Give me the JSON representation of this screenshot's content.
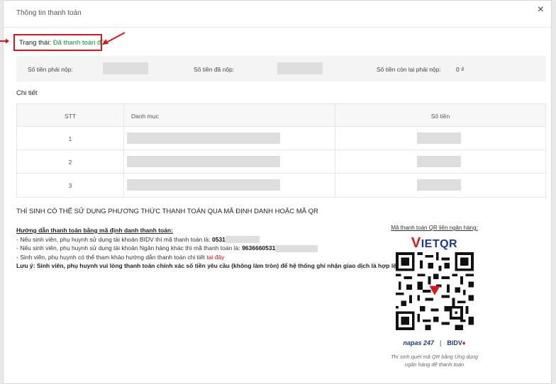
{
  "modal": {
    "title": "Thông tin thanh toán",
    "close_glyph": "×"
  },
  "status": {
    "label": "Trạng thái:",
    "value": "Đã thanh toán đủ",
    "value_color": "#0a9a2f",
    "highlight_color": "#e0141c"
  },
  "summary": {
    "due_label": "Số tiền phải nộp:",
    "paid_label": "Số tiền đã nộp:",
    "remaining_label": "Số tiền còn lại phải nộp:",
    "remaining_value": "0 ₫"
  },
  "details": {
    "title": "Chi tiết",
    "columns": [
      "STT",
      "Danh mục",
      "Số tiền"
    ],
    "rows": [
      {
        "stt": "1"
      },
      {
        "stt": "2"
      },
      {
        "stt": "3"
      }
    ]
  },
  "payment": {
    "title": "THÍ SINH CÓ THỂ SỬ DỤNG PHƯƠNG THỨC THANH TOÁN QUA MÃ ĐỊNH DANH HOẶC MÃ QR",
    "guide_title": "Hướng dẫn thanh toán bằng mã định danh thanh toán:",
    "line1_prefix": "- Nếu sinh viên, phụ huynh sử dụng tài khoản BIDV thì mã thanh toán là:",
    "line1_code": "0531",
    "line2_prefix": "- Nếu sinh viên, phụ huynh sử dụng tài khoản Ngân hàng khác thì mã thanh toán là:",
    "line2_code": "9636660531",
    "line3_prefix": "- Sinh viên, phụ huynh có thể tham khảo hướng dẫn thanh toán chi tiết",
    "line3_link": "tại đây",
    "note": "Lưu ý: Sinh viên, phụ huynh vui lòng thanh toán chính xác số tiền yêu cầu (không làm tròn) để hệ thống ghi nhận giao dịch là hợp lệ"
  },
  "qr": {
    "title": "Mã thanh toán QR liên ngân hàng:",
    "logo_v": "V",
    "logo_rest": "IETQR",
    "napas": "napas 247",
    "bidv": "BIDV",
    "note": "Thí sinh quét mã QR bằng Ứng dụng ngân hàng để thanh toán"
  }
}
